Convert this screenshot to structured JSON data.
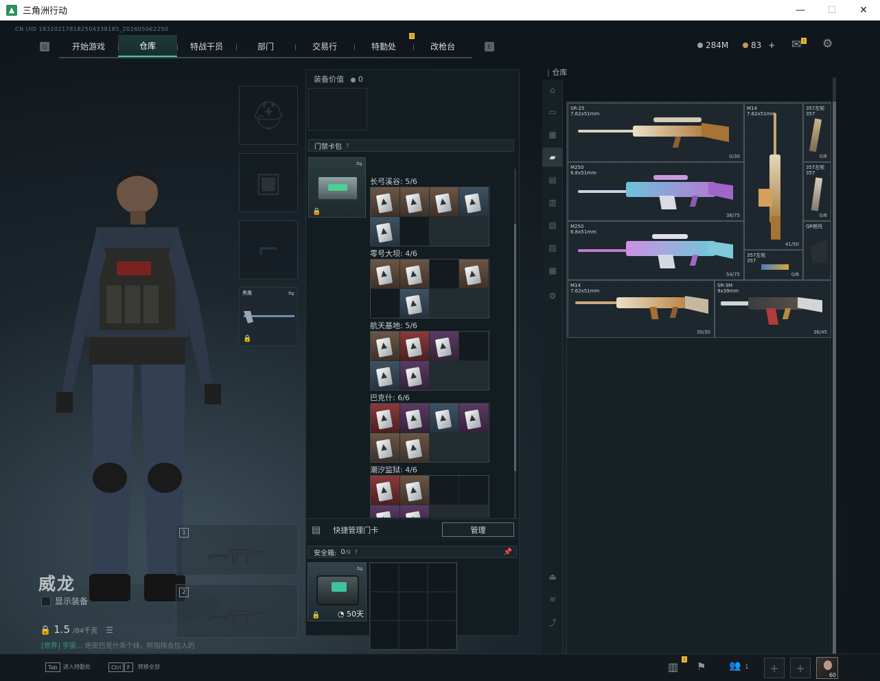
{
  "window": {
    "title": "三角洲行动",
    "minimize": "—",
    "maximize": "☐",
    "close": "✕"
  },
  "uid": "CN UID 1832021781825043381​85_202605062250",
  "nav": {
    "left_key": "Q",
    "right_key": "E",
    "tabs": [
      "开始游戏",
      "仓库",
      "特战干员",
      "部门",
      "交易行",
      "特勤处",
      "改枪台"
    ],
    "active_tab": "仓库",
    "badge": "!"
  },
  "currency": {
    "coins": "284M",
    "tickets": "83",
    "add": "+"
  },
  "icons": {
    "mail": "mail-icon",
    "settings": "gear-icon"
  },
  "character": {
    "name": "威龙",
    "show_gear_label": "显示装备",
    "weight": "1.5",
    "weight_max": "/84千克"
  },
  "chat": {
    "channel": "[世界]",
    "user": "宇宙...",
    "message": "绝密巴克什来个妹，听指挥会拉人的"
  },
  "equip": {
    "value_label": "装备价值",
    "value": "0"
  },
  "keycard_bag": {
    "label": "门禁卡包",
    "help": "?",
    "groups": [
      {
        "title": "长弓溪谷: 5/6"
      },
      {
        "title": "零号大坝: 4/6"
      },
      {
        "title": "航天基地: 5/6"
      },
      {
        "title": "巴克什: 6/6"
      },
      {
        "title": "潮汐监狱: 4/6"
      }
    ],
    "quick_manage_label": "快捷管理门卡",
    "manage_button": "管理"
  },
  "safebox": {
    "label": "安全箱:",
    "count": "0",
    "capacity": "/9",
    "help": "?",
    "timer": "50天"
  },
  "melee_slot": {
    "label": "黑鹰"
  },
  "weapon_slots": [
    "1",
    "2"
  ],
  "stash": {
    "title": "仓库",
    "items": [
      {
        "name": "SR-25\n7.62x51mm",
        "ammo": "0/30"
      },
      {
        "name": "M14\n7.62x51mm",
        "ammo": "41/50"
      },
      {
        "name": "357左轮\n357",
        "ammo": "0/6"
      },
      {
        "name": "M250\n6.8x51mm",
        "ammo": "38/75"
      },
      {
        "name": "357左轮\n357",
        "ammo": "0/6"
      },
      {
        "name": "M250\n6.8x51mm",
        "ammo": "54/75"
      },
      {
        "name": "357左轮\n357",
        "ammo": "0/6"
      },
      {
        "name": "QR枪托",
        "ammo": ""
      },
      {
        "name": "M14\n7.62x51mm",
        "ammo": "30/30"
      },
      {
        "name": "SR-3M\n9x39mm",
        "ammo": "36/45"
      }
    ]
  },
  "bottom": {
    "tab_key": "Tab",
    "tab_label": "进入特勤处",
    "ctrl_key": "Ctrl",
    "f_key": "F",
    "transfer_label": "转移全部",
    "squad_count": "1",
    "avatar_level": "60"
  },
  "colors": {
    "accent": "#47c9a3",
    "badge": "#e8b730"
  }
}
